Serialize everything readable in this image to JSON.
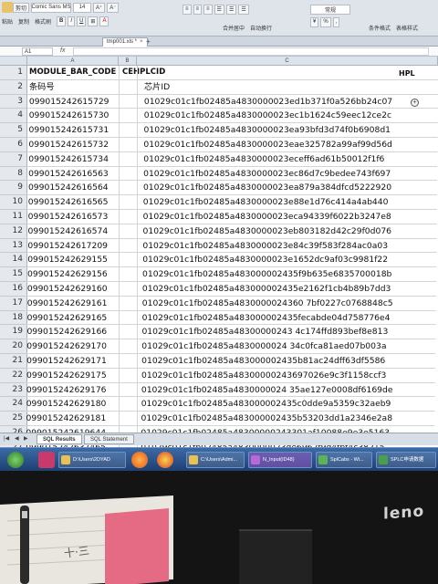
{
  "ribbon": {
    "font_name": "Comic Sans MS",
    "font_size": "14",
    "paste_label": "粘贴",
    "cut_label": "剪切",
    "copy_label": "复制",
    "format_painter_label": "格式刷",
    "merge_label": "合并居中",
    "wrap_label": "自动换行",
    "number_format": "常规",
    "conditional_format_label": "条件格式",
    "table_style_label": "表格样式"
  },
  "file_tab": {
    "label": "tmp001.xls *"
  },
  "formula_bar": {
    "cell_ref": "A1",
    "fx": "fx",
    "value": ""
  },
  "grid": {
    "columns": [
      "A",
      "B",
      "C"
    ],
    "header_row": {
      "row": "1",
      "a": "MODULE_BAR_CODE",
      "b": "CEHPLCID",
      "c": "HPL"
    },
    "row_numbers": [
      "1",
      "2",
      "3",
      "4",
      "5",
      "6",
      "7",
      "8",
      "9",
      "10",
      "11",
      "12",
      "13",
      "14",
      "15",
      "16",
      "17",
      "18",
      "19",
      "20",
      "21",
      "22",
      "23",
      "24",
      "25",
      "26",
      "27"
    ],
    "rows": [
      {
        "a": "条码号",
        "b": "芯片ID"
      },
      {
        "a": "099015242615729",
        "b": "01029c01c1fb02485a4830000023ed1b371f0a526bb24c07"
      },
      {
        "a": "099015242615730",
        "b": "01029c01c1fb02485a4830000023ec1b1624c59eec12ce2c"
      },
      {
        "a": "099015242615731",
        "b": "01029c01c1fb02485a4830000023ea93bfd3d74f0b6908d1"
      },
      {
        "a": "099015242615732",
        "b": "01029c01c1fb02485a4830000023eae325782a99af99d56d"
      },
      {
        "a": "099015242615734",
        "b": "01029c01c1fb02485a4830000023eceff6ad61b50012f1f6"
      },
      {
        "a": "099015242616563",
        "b": "01029c01c1fb02485a4830000023ec86d7c9bedee743f697"
      },
      {
        "a": "099015242616564",
        "b": "01029c01c1fb02485a4830000023ea879a384dfcd5222920"
      },
      {
        "a": "099015242616565",
        "b": "01029c01c1fb02485a4830000023e88e1d76c414a4ab440"
      },
      {
        "a": "099015242616573",
        "b": "01029c01c1fb02485a4830000023eca94339f6022b3247e8"
      },
      {
        "a": "099015242616574",
        "b": "01029c01c1fb02485a4830000023eb803182d42c29f0d076"
      },
      {
        "a": "099015242617209",
        "b": "01029c01c1fb02485a4830000023e84c39f583f284ac0a03"
      },
      {
        "a": "099015242629155",
        "b": "01029c01c1fb02485a4830000023e1652dc9af03c9981f22"
      },
      {
        "a": "099015242629156",
        "b": "01029c01c1fb02485a483000002435f9b635e6835700018b"
      },
      {
        "a": "099015242629160",
        "b": "01029c01c1fb02485a483000002435e2162f1cb4b89b7dd3"
      },
      {
        "a": "099015242629161",
        "b": "01029c01c1fb02485a4830000024360 7bf0227c0768848c5"
      },
      {
        "a": "099015242629165",
        "b": "01029c01c1fb02485a483000002435fecabde04d758776e4"
      },
      {
        "a": "099015242629166",
        "b": "01029c01c1fb02485a48300000243 4c174ffd893bef8e813"
      },
      {
        "a": "099015242629170",
        "b": "01029c01c1fb02485a4830000024 34c0fca81aed07b003a"
      },
      {
        "a": "099015242629171",
        "b": "01029c01c1fb02485a483000002435b81ac24dff63df5586"
      },
      {
        "a": "099015242629175",
        "b": "01029c01c1fb02485a48300000243697026e9c3f1158ccf3"
      },
      {
        "a": "099015242629176",
        "b": "01029c01c1fb02485a4830000024 35ae127e0008df6169de"
      },
      {
        "a": "099015242629180",
        "b": "01029c01c1fb02485a483000002435c0dde9a5359c32aeb9"
      },
      {
        "a": "099015242629181",
        "b": "01029c01c1fb02485a483000002435b53203dd1a2346e2a8"
      },
      {
        "a": "099015242619644",
        "b": "01029c01c1fb02485a48300000243301af10088e9e3e5163"
      },
      {
        "a": "099015242637465",
        "b": "01029c01c1fb02485a4830000023de6962f9d4fbf4c38215"
      },
      {
        "a": "",
        "b": "01029c01c1fb02485a48300000244b6486bb392a5d1175bb"
      }
    ]
  },
  "sheet_tabs": [
    "SQL Results",
    "SQL Statement"
  ],
  "taskbar": {
    "items": [
      "D:\\Users\\2DYAD",
      "C:\\Users\\Admi...",
      "N_Input(ID48)",
      "SplCabs - Wi...",
      "SPLC申请数据"
    ]
  },
  "bezel": {
    "brand": "leno"
  },
  "colors": {
    "ribbon_bg": "#dfe4ea",
    "grid_line": "#d0d5da",
    "taskbar": "#2a5590",
    "highlight_text": "#111111"
  }
}
